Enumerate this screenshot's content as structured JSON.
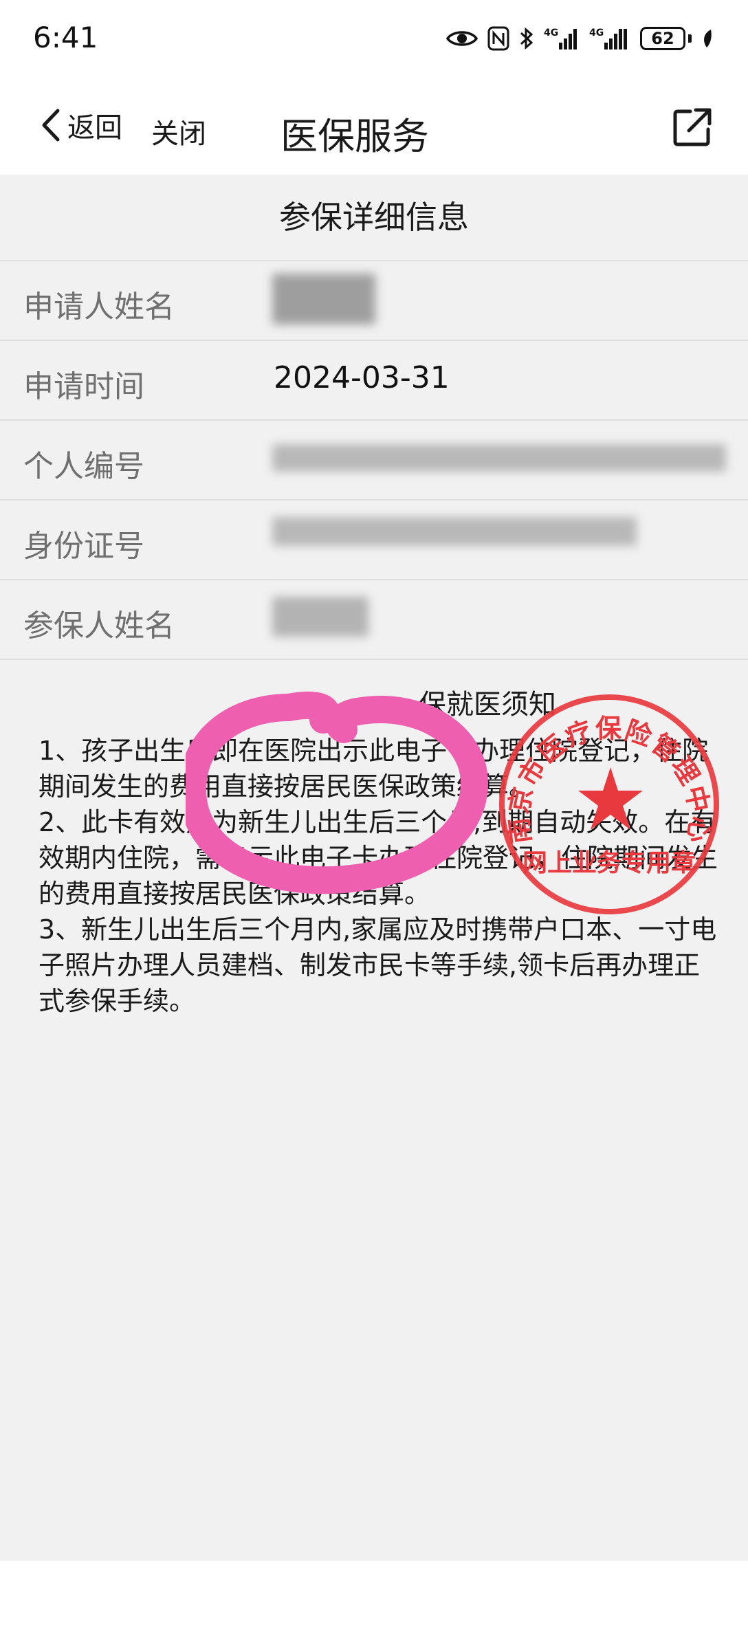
{
  "status_bar": {
    "time": "6:41",
    "battery_level": "62",
    "icons": [
      "eye-icon",
      "nfc-icon",
      "bluetooth-icon",
      "signal-4g-icon",
      "signal-4g-icon",
      "battery-icon",
      "leaf-icon"
    ]
  },
  "nav": {
    "back_label": "返回",
    "close_label": "关闭",
    "title": "医保服务",
    "share_icon": "external-link-icon"
  },
  "section_title": "参保详细信息",
  "info_rows": [
    {
      "label": "申请人姓名",
      "value": ""
    },
    {
      "label": "申请时间",
      "value": "2024-03-31"
    },
    {
      "label": "个人编号",
      "value": ""
    },
    {
      "label": "身份证号",
      "value": ""
    },
    {
      "label": "参保人姓名",
      "value": ""
    }
  ],
  "notice": {
    "title_visible_right": "保就医须知",
    "items": [
      "1、孩子出生后即在医院出示此电子卡办理住院登记，住院期间发生的费用直接按居民医保政策结算。",
      "2、此卡有效期为新生儿出生后三个月,到期自动失效。在有效期内住院，需出示此电子卡办理住院登记，住院期间发生的费用直接按居民医保政策结算。",
      "3、新生儿出生后三个月内,家属应及时携带户口本、一寸电子照片办理人员建档、制发市民卡等手续,领卡后再办理正式参保手续。"
    ]
  },
  "stamp": {
    "top_text": "南京市医疗保险管理中心",
    "bottom_text": "网上业务专用章",
    "color": "#e8393f"
  },
  "colors": {
    "page_bg": "#f1f1f1",
    "header_bg": "#ffffff",
    "label_text": "#6f6f6f",
    "annotation_pink": "#ee5fb0"
  }
}
